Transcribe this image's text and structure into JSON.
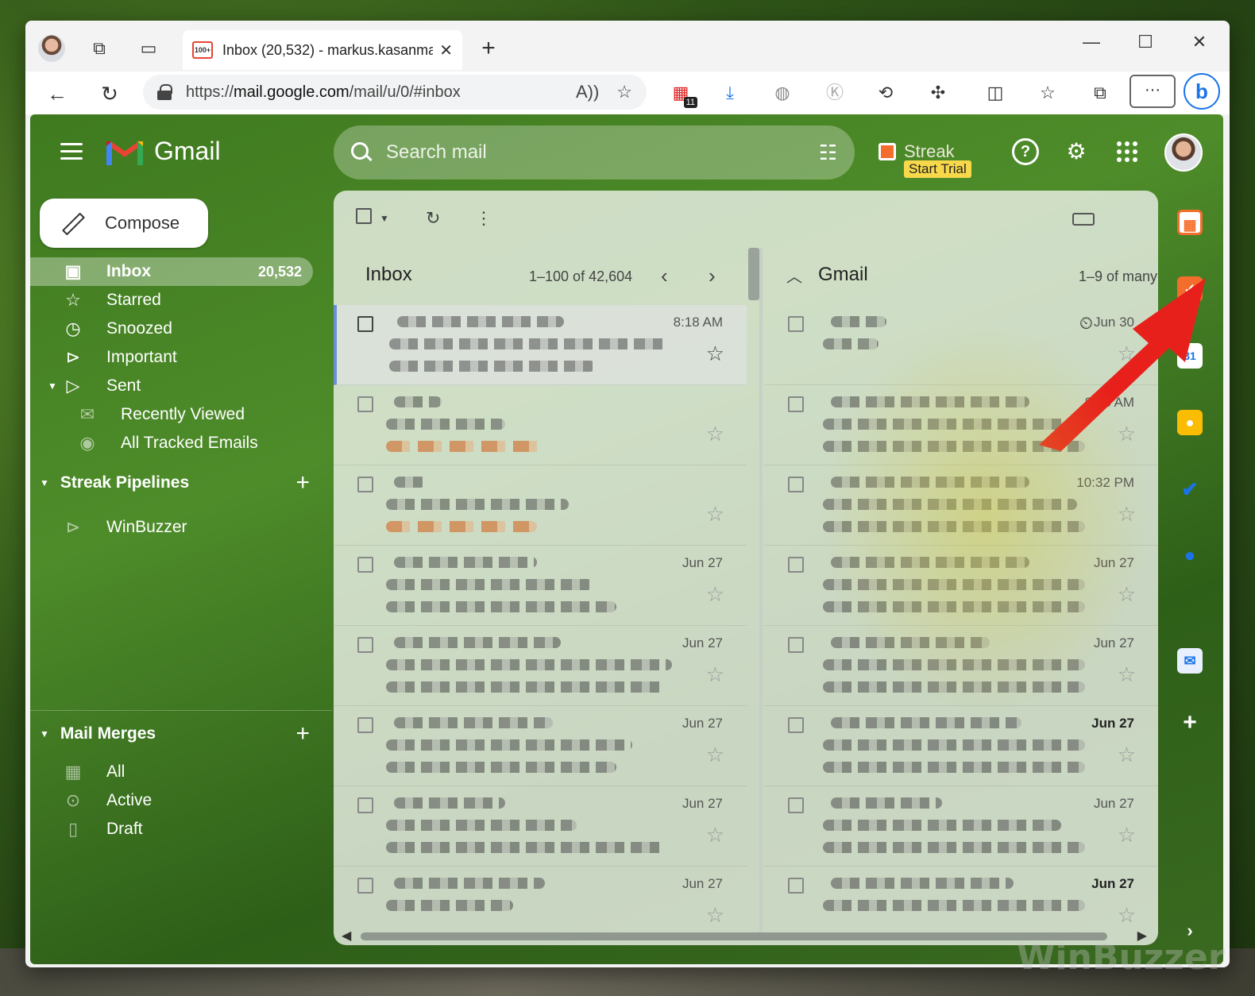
{
  "browser": {
    "tab_title": "Inbox (20,532) - markus.kasanma",
    "tab_favicon_badge": "100+",
    "url_prefix": "https://",
    "url_host": "mail.google.com",
    "url_path": "/mail/u/0/#inbox",
    "extension_badge": "11"
  },
  "gmail": {
    "brand": "Gmail",
    "search_placeholder": "Search mail",
    "streak_label": "Streak",
    "streak_trial": "Start Trial",
    "compose_label": "Compose",
    "nav": [
      {
        "label": "Inbox",
        "count": "20,532",
        "icon": "inbox-icon"
      },
      {
        "label": "Starred",
        "icon": "star-icon"
      },
      {
        "label": "Snoozed",
        "icon": "clock-icon"
      },
      {
        "label": "Important",
        "icon": "important-icon"
      },
      {
        "label": "Sent",
        "icon": "send-icon"
      },
      {
        "label": "Recently Viewed",
        "icon": "envelope-open-icon"
      },
      {
        "label": "All Tracked Emails",
        "icon": "eye-icon"
      }
    ],
    "streak_pipelines": {
      "title": "Streak Pipelines",
      "items": [
        "WinBuzzer"
      ]
    },
    "mail_merges": {
      "title": "Mail Merges",
      "items": [
        "All",
        "Active",
        "Draft"
      ]
    },
    "inbox_pane": {
      "title": "Inbox",
      "range": "1–100 of 42,604",
      "dates": [
        "8:18 AM",
        "",
        "",
        "Jun 27",
        "Jun 27",
        "Jun 27",
        "Jun 27",
        "Jun 27"
      ]
    },
    "gmail_pane": {
      "title": "Gmail",
      "range": "1–9 of many",
      "dates": [
        "Jun 30",
        "8:18 AM",
        "10:32 PM",
        "Jun 27",
        "Jun 27",
        "Jun 27",
        "Jun 27",
        "Jun 27"
      ],
      "bold_dates": [
        false,
        false,
        false,
        false,
        false,
        true,
        false,
        true
      ]
    }
  },
  "watermark": "WinBuzzer",
  "colors": {
    "annotation_arrow": "#e8201b",
    "gmail_red": "#ea4335"
  }
}
